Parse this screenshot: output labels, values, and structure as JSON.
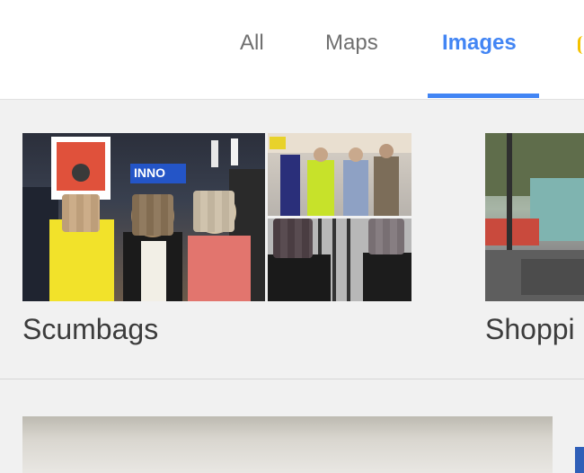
{
  "tabs": [
    {
      "label": "All"
    },
    {
      "label": "Maps"
    },
    {
      "label": "Images"
    }
  ],
  "active_tab": "Images",
  "cards": [
    {
      "label": "Scumbags",
      "sign_text": "INNO"
    },
    {
      "label": "Shoppi"
    }
  ],
  "colors": {
    "accent": "#4285f4",
    "background": "#f1f1f1",
    "topbar": "#ffffff",
    "label_text": "#3c3c3c",
    "tab_text": "#6f6f6f"
  }
}
